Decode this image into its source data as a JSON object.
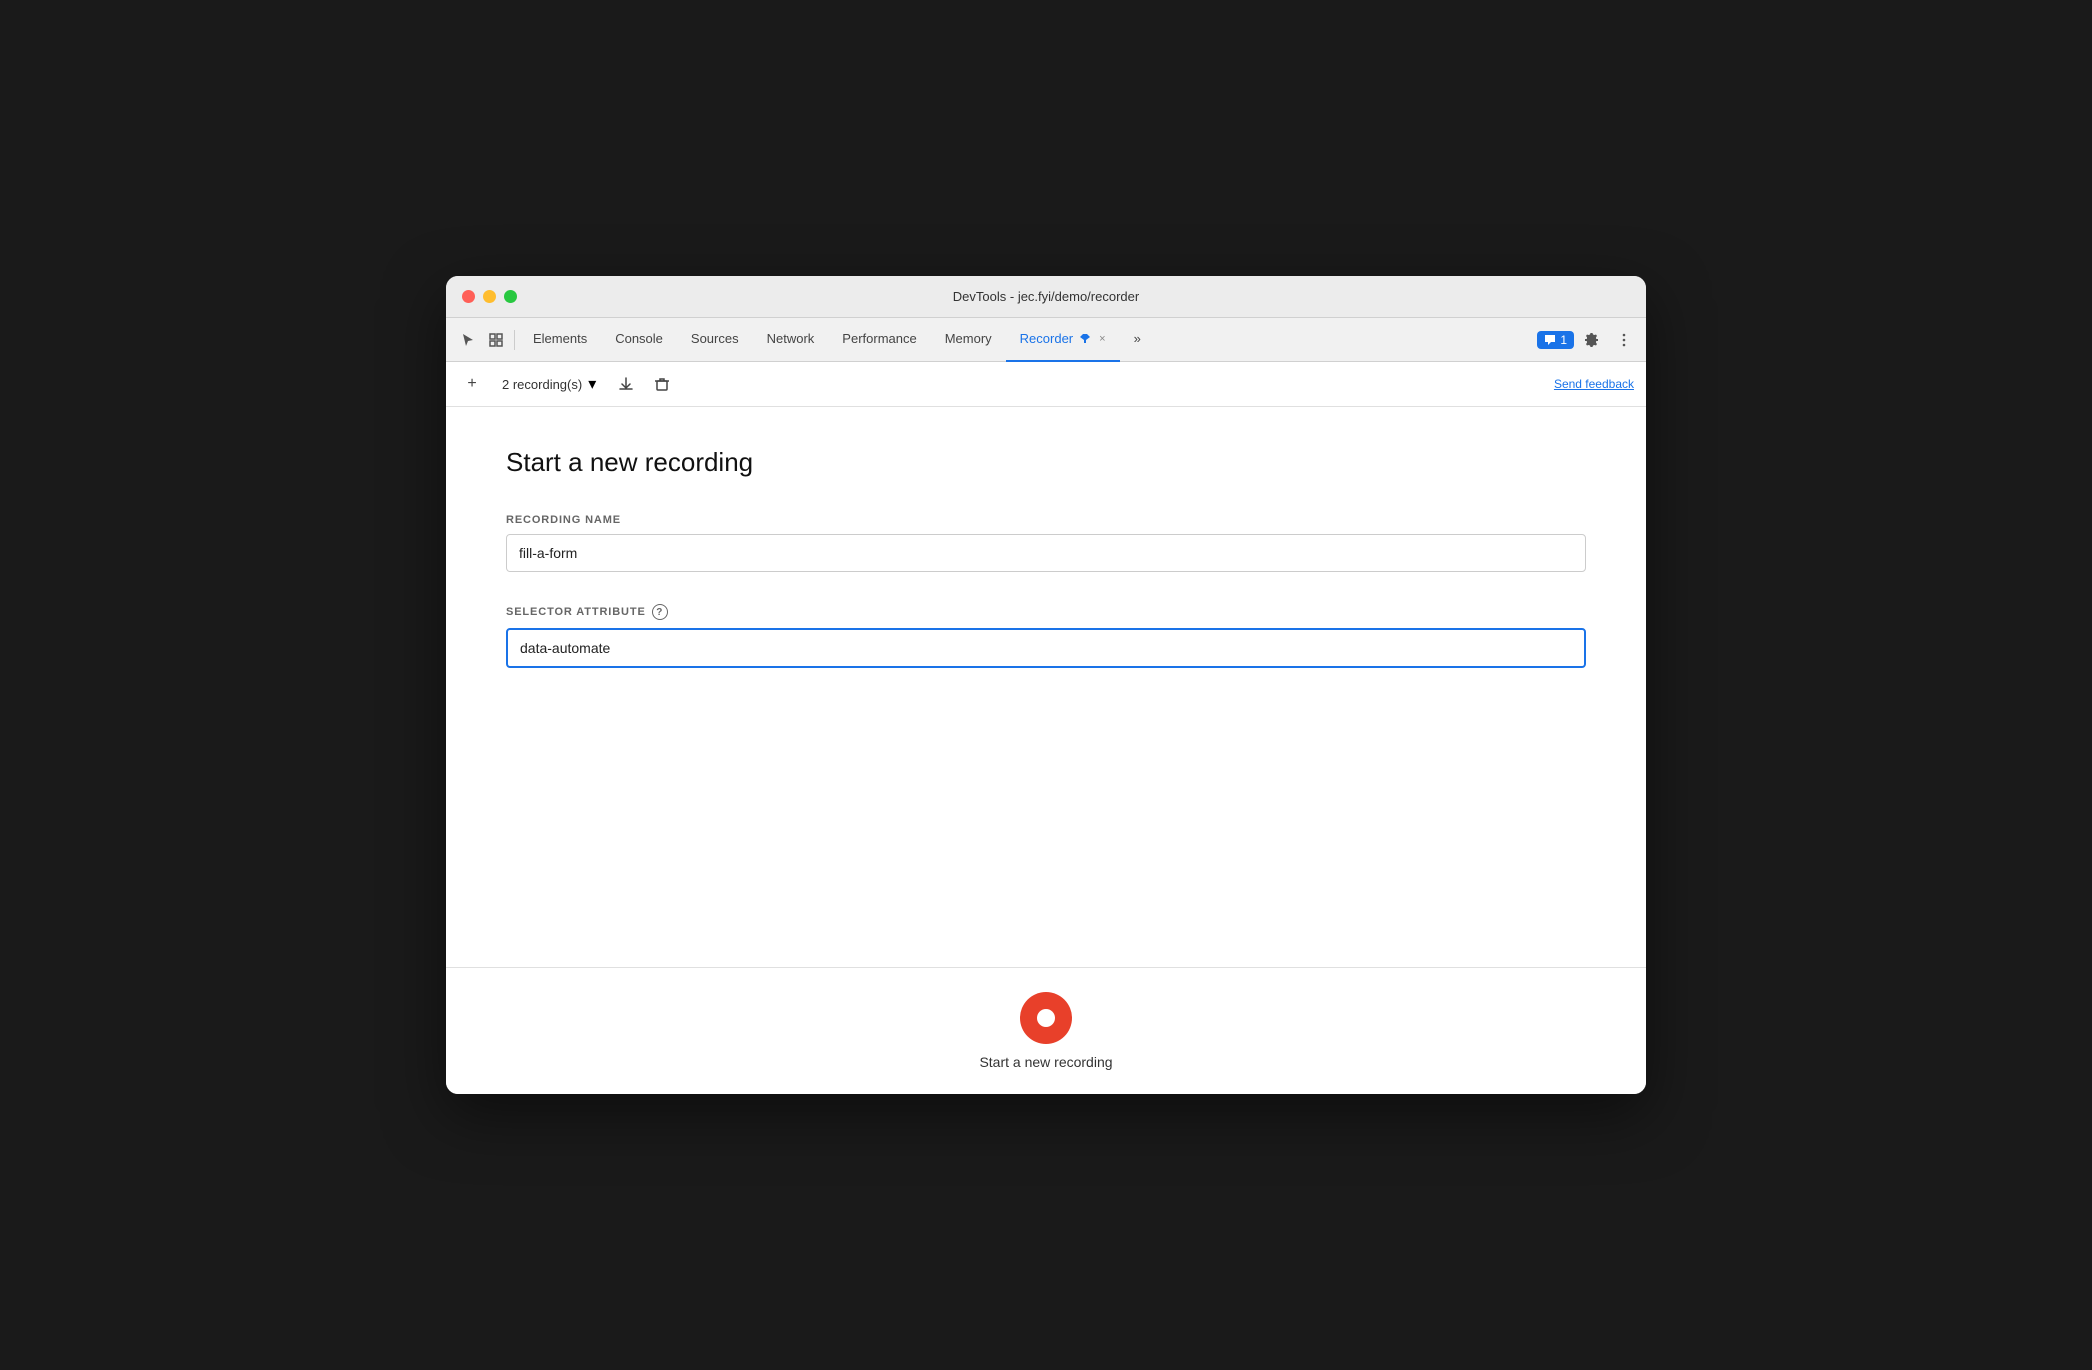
{
  "window": {
    "title": "DevTools - jec.fyi/demo/recorder"
  },
  "tabs": {
    "items": [
      {
        "label": "Elements",
        "active": false
      },
      {
        "label": "Console",
        "active": false
      },
      {
        "label": "Sources",
        "active": false
      },
      {
        "label": "Network",
        "active": false
      },
      {
        "label": "Performance",
        "active": false
      },
      {
        "label": "Memory",
        "active": false
      },
      {
        "label": "Recorder",
        "active": true
      },
      {
        "label": "»",
        "active": false
      }
    ],
    "more_label": "»",
    "chat_count": "1",
    "recorder_close": "×"
  },
  "toolbar": {
    "add_icon": "+",
    "recordings_label": "2 recording(s)",
    "dropdown_arrow": "▾",
    "download_icon": "⬇",
    "delete_icon": "🗑",
    "send_feedback": "Send feedback"
  },
  "main": {
    "page_title": "Start a new recording",
    "recording_name_label": "RECORDING NAME",
    "recording_name_value": "fill-a-form",
    "selector_attribute_label": "SELECTOR ATTRIBUTE",
    "selector_help": "?",
    "selector_value": "data-automate"
  },
  "footer": {
    "record_label": "Start a new recording"
  }
}
